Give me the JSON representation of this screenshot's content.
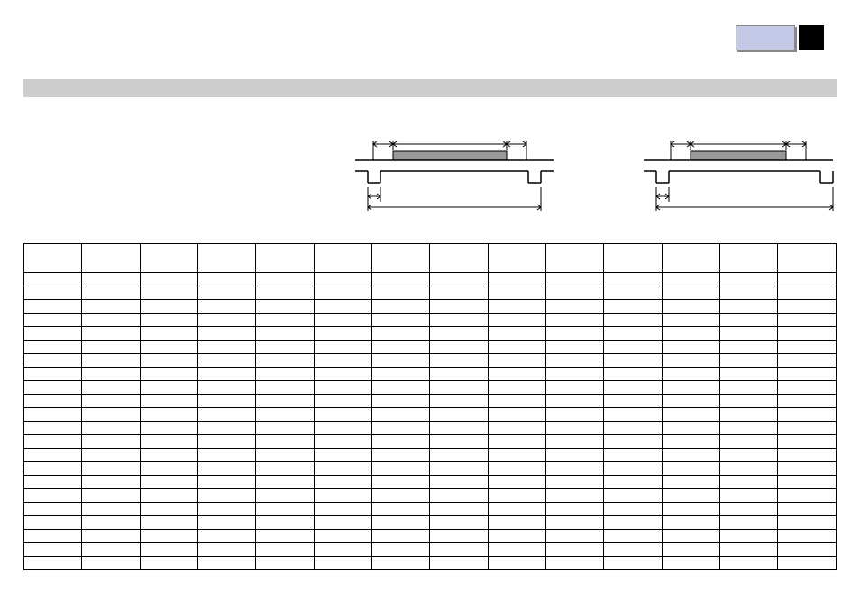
{
  "header": {
    "indicator": {
      "leftColor": "#c5c9e8",
      "rightColor": "#000000"
    },
    "barColor": "#cdcdcd"
  },
  "diagrams": {
    "left": {
      "label": ""
    },
    "right": {
      "label": ""
    }
  },
  "table": {
    "columns": 14,
    "headerRow": [
      "",
      "",
      "",
      "",
      "",
      "",
      "",
      "",
      "",
      "",
      "",
      "",
      "",
      ""
    ],
    "rows": [
      [
        "",
        "",
        "",
        "",
        "",
        "",
        "",
        "",
        "",
        "",
        "",
        "",
        "",
        ""
      ],
      [
        "",
        "",
        "",
        "",
        "",
        "",
        "",
        "",
        "",
        "",
        "",
        "",
        "",
        ""
      ],
      [
        "",
        "",
        "",
        "",
        "",
        "",
        "",
        "",
        "",
        "",
        "",
        "",
        "",
        ""
      ],
      [
        "",
        "",
        "",
        "",
        "",
        "",
        "",
        "",
        "",
        "",
        "",
        "",
        "",
        ""
      ],
      [
        "",
        "",
        "",
        "",
        "",
        "",
        "",
        "",
        "",
        "",
        "",
        "",
        "",
        ""
      ],
      [
        "",
        "",
        "",
        "",
        "",
        "",
        "",
        "",
        "",
        "",
        "",
        "",
        "",
        ""
      ],
      [
        "",
        "",
        "",
        "",
        "",
        "",
        "",
        "",
        "",
        "",
        "",
        "",
        "",
        ""
      ],
      [
        "",
        "",
        "",
        "",
        "",
        "",
        "",
        "",
        "",
        "",
        "",
        "",
        "",
        ""
      ],
      [
        "",
        "",
        "",
        "",
        "",
        "",
        "",
        "",
        "",
        "",
        "",
        "",
        "",
        ""
      ],
      [
        "",
        "",
        "",
        "",
        "",
        "",
        "",
        "",
        "",
        "",
        "",
        "",
        "",
        ""
      ],
      [
        "",
        "",
        "",
        "",
        "",
        "",
        "",
        "",
        "",
        "",
        "",
        "",
        "",
        ""
      ],
      [
        "",
        "",
        "",
        "",
        "",
        "",
        "",
        "",
        "",
        "",
        "",
        "",
        "",
        ""
      ],
      [
        "",
        "",
        "",
        "",
        "",
        "",
        "",
        "",
        "",
        "",
        "",
        "",
        "",
        ""
      ],
      [
        "",
        "",
        "",
        "",
        "",
        "",
        "",
        "",
        "",
        "",
        "",
        "",
        "",
        ""
      ],
      [
        "",
        "",
        "",
        "",
        "",
        "",
        "",
        "",
        "",
        "",
        "",
        "",
        "",
        ""
      ],
      [
        "",
        "",
        "",
        "",
        "",
        "",
        "",
        "",
        "",
        "",
        "",
        "",
        "",
        ""
      ],
      [
        "",
        "",
        "",
        "",
        "",
        "",
        "",
        "",
        "",
        "",
        "",
        "",
        "",
        ""
      ],
      [
        "",
        "",
        "",
        "",
        "",
        "",
        "",
        "",
        "",
        "",
        "",
        "",
        "",
        ""
      ],
      [
        "",
        "",
        "",
        "",
        "",
        "",
        "",
        "",
        "",
        "",
        "",
        "",
        "",
        ""
      ],
      [
        "",
        "",
        "",
        "",
        "",
        "",
        "",
        "",
        "",
        "",
        "",
        "",
        "",
        ""
      ],
      [
        "",
        "",
        "",
        "",
        "",
        "",
        "",
        "",
        "",
        "",
        "",
        "",
        "",
        ""
      ],
      [
        "",
        "",
        "",
        "",
        "",
        "",
        "",
        "",
        "",
        "",
        "",
        "",
        "",
        ""
      ]
    ]
  }
}
